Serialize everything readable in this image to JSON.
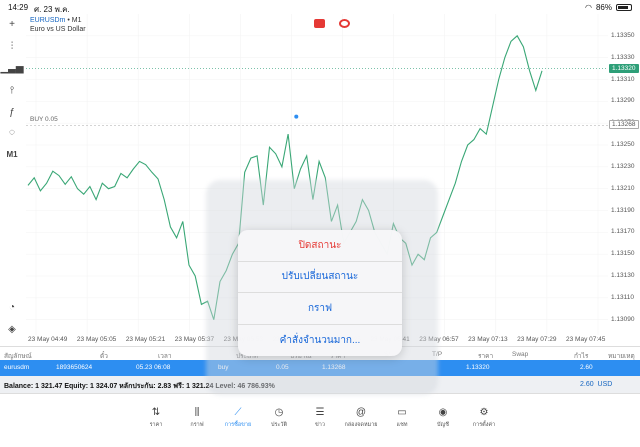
{
  "status_bar": {
    "time": "14:29",
    "date": "ศ. 23 พ.ค.",
    "battery": "86%",
    "battery_level": 0.86
  },
  "symbol": {
    "name": "EURUSDm",
    "timeframe": "M1",
    "description": "Euro vs US Dollar"
  },
  "toolbar": {
    "items": [
      {
        "name": "crosshair-icon",
        "glyph": "+"
      },
      {
        "name": "candlestick-icon",
        "glyph": "⫶"
      },
      {
        "name": "bar-chart-icon",
        "glyph": "▁▃▅"
      },
      {
        "name": "indicators-icon",
        "glyph": "⫯"
      },
      {
        "name": "function-icon",
        "glyph": "ƒ"
      },
      {
        "name": "shapes-icon",
        "glyph": "◌"
      },
      {
        "name": "timeframe-label",
        "glyph": "M1"
      },
      {
        "name": "speed-gauge-icon",
        "glyph": "◔"
      },
      {
        "name": "exness-icon",
        "glyph": "◈"
      }
    ]
  },
  "chart_labels": {
    "buy_line": "BUY 0.05"
  },
  "chart_data": {
    "type": "line",
    "y_ticks": [
      "1.13350",
      "1.13330",
      "1.13310",
      "1.13290",
      "1.13270",
      "1.13250",
      "1.13230",
      "1.13210",
      "1.13190",
      "1.13170",
      "1.13150",
      "1.13130",
      "1.13110",
      "1.13090"
    ],
    "ylim": [
      1.13076,
      1.1337
    ],
    "x_ticks": [
      "23 May 04:49",
      "23 May 05:05",
      "23 May 05:21",
      "23 May 05:37",
      "23 May 05:53",
      "23 May 06:09",
      "23 May 06:25",
      "23 May 06:41",
      "23 May 06:57",
      "23 May 07:13",
      "23 May 07:29",
      "23 May 07:45"
    ],
    "current_price": "1.13320",
    "buy_price": "1.13268",
    "values": [
      1.13213,
      1.1322,
      1.13208,
      1.13215,
      1.13226,
      1.13222,
      1.13214,
      1.13221,
      1.1321,
      1.13205,
      1.13212,
      1.132,
      1.13215,
      1.1321,
      1.13212,
      1.13224,
      1.1322,
      1.13228,
      1.13235,
      1.13232,
      1.13225,
      1.13219,
      1.132,
      1.13175,
      1.13165,
      1.1318,
      1.1314,
      1.1313,
      1.13104,
      1.13107,
      1.1309,
      1.13125,
      1.13135,
      1.1315,
      1.1316,
      1.13225,
      1.13238,
      1.1324,
      1.13195,
      1.13248,
      1.13242,
      1.1323,
      1.1326,
      1.1321,
      1.13228,
      1.1324,
      1.132,
      1.13235,
      1.1322,
      1.1318,
      1.13195,
      1.1316,
      1.1317,
      1.1318,
      1.132,
      1.1319,
      1.1317,
      1.1316,
      1.1315,
      1.13178,
      1.13165,
      1.1316,
      1.1314,
      1.1315,
      1.13145,
      1.13165,
      1.1317,
      1.13185,
      1.132,
      1.13215,
      1.13235,
      1.1325,
      1.13255,
      1.13265,
      1.1326,
      1.13285,
      1.1331,
      1.1333,
      1.13345,
      1.1335,
      1.1334,
      1.13318,
      1.133,
      1.13318
    ]
  },
  "table": {
    "headers": [
      "สัญลักษณ์",
      "ตั๋ว",
      "เวลา",
      "ประเภท",
      "ปริมาณ",
      "ราคา",
      "S/L",
      "T/P",
      "ราคา",
      "Swap",
      "กำไร",
      "หมายเหตุ"
    ],
    "row": {
      "symbol": "eurusdm",
      "ticket": "1893650624",
      "time": "05.23 06:08",
      "type": "buy",
      "volume": "0.05",
      "open_price": "1.13268",
      "current_price": "1.13320",
      "profit": "2.60"
    }
  },
  "balance": {
    "text": "Balance: 1 321.47  Equity: 1 324.07  หลักประกัน: 2.83  ฟรี: 1 321.24  Level: 46 786.93%",
    "value": "2.60",
    "currency": "USD"
  },
  "nav": [
    {
      "name": "quotes",
      "label": "ราคา",
      "icon": "⇅",
      "active": false
    },
    {
      "name": "charts",
      "label": "กราฟ",
      "icon": "⫼",
      "active": false
    },
    {
      "name": "trade",
      "label": "การซื้อขาย",
      "icon": "⟋",
      "active": true
    },
    {
      "name": "history",
      "label": "ประวัติ",
      "icon": "◷",
      "active": false
    },
    {
      "name": "news",
      "label": "ข่าว",
      "icon": "☰",
      "active": false
    },
    {
      "name": "mailbox",
      "label": "กล่องจดหมาย",
      "icon": "@",
      "active": false
    },
    {
      "name": "chat",
      "label": "แชท",
      "icon": "▭",
      "active": false
    },
    {
      "name": "accounts",
      "label": "บัญชี",
      "icon": "◉",
      "active": false
    },
    {
      "name": "settings",
      "label": "การตั้งค่า",
      "icon": "⚙",
      "active": false
    }
  ],
  "context_menu": {
    "close_position": "ปิดสถานะ",
    "modify_position": "ปรับเปลี่ยนสถานะ",
    "chart": "กราฟ",
    "bulk_orders": "คำสั่งจำนวนมาก..."
  },
  "colors": {
    "line": "#3aa776",
    "accent": "#2d8ef1",
    "danger": "#e53935",
    "price_mark": "#2e9f78"
  }
}
